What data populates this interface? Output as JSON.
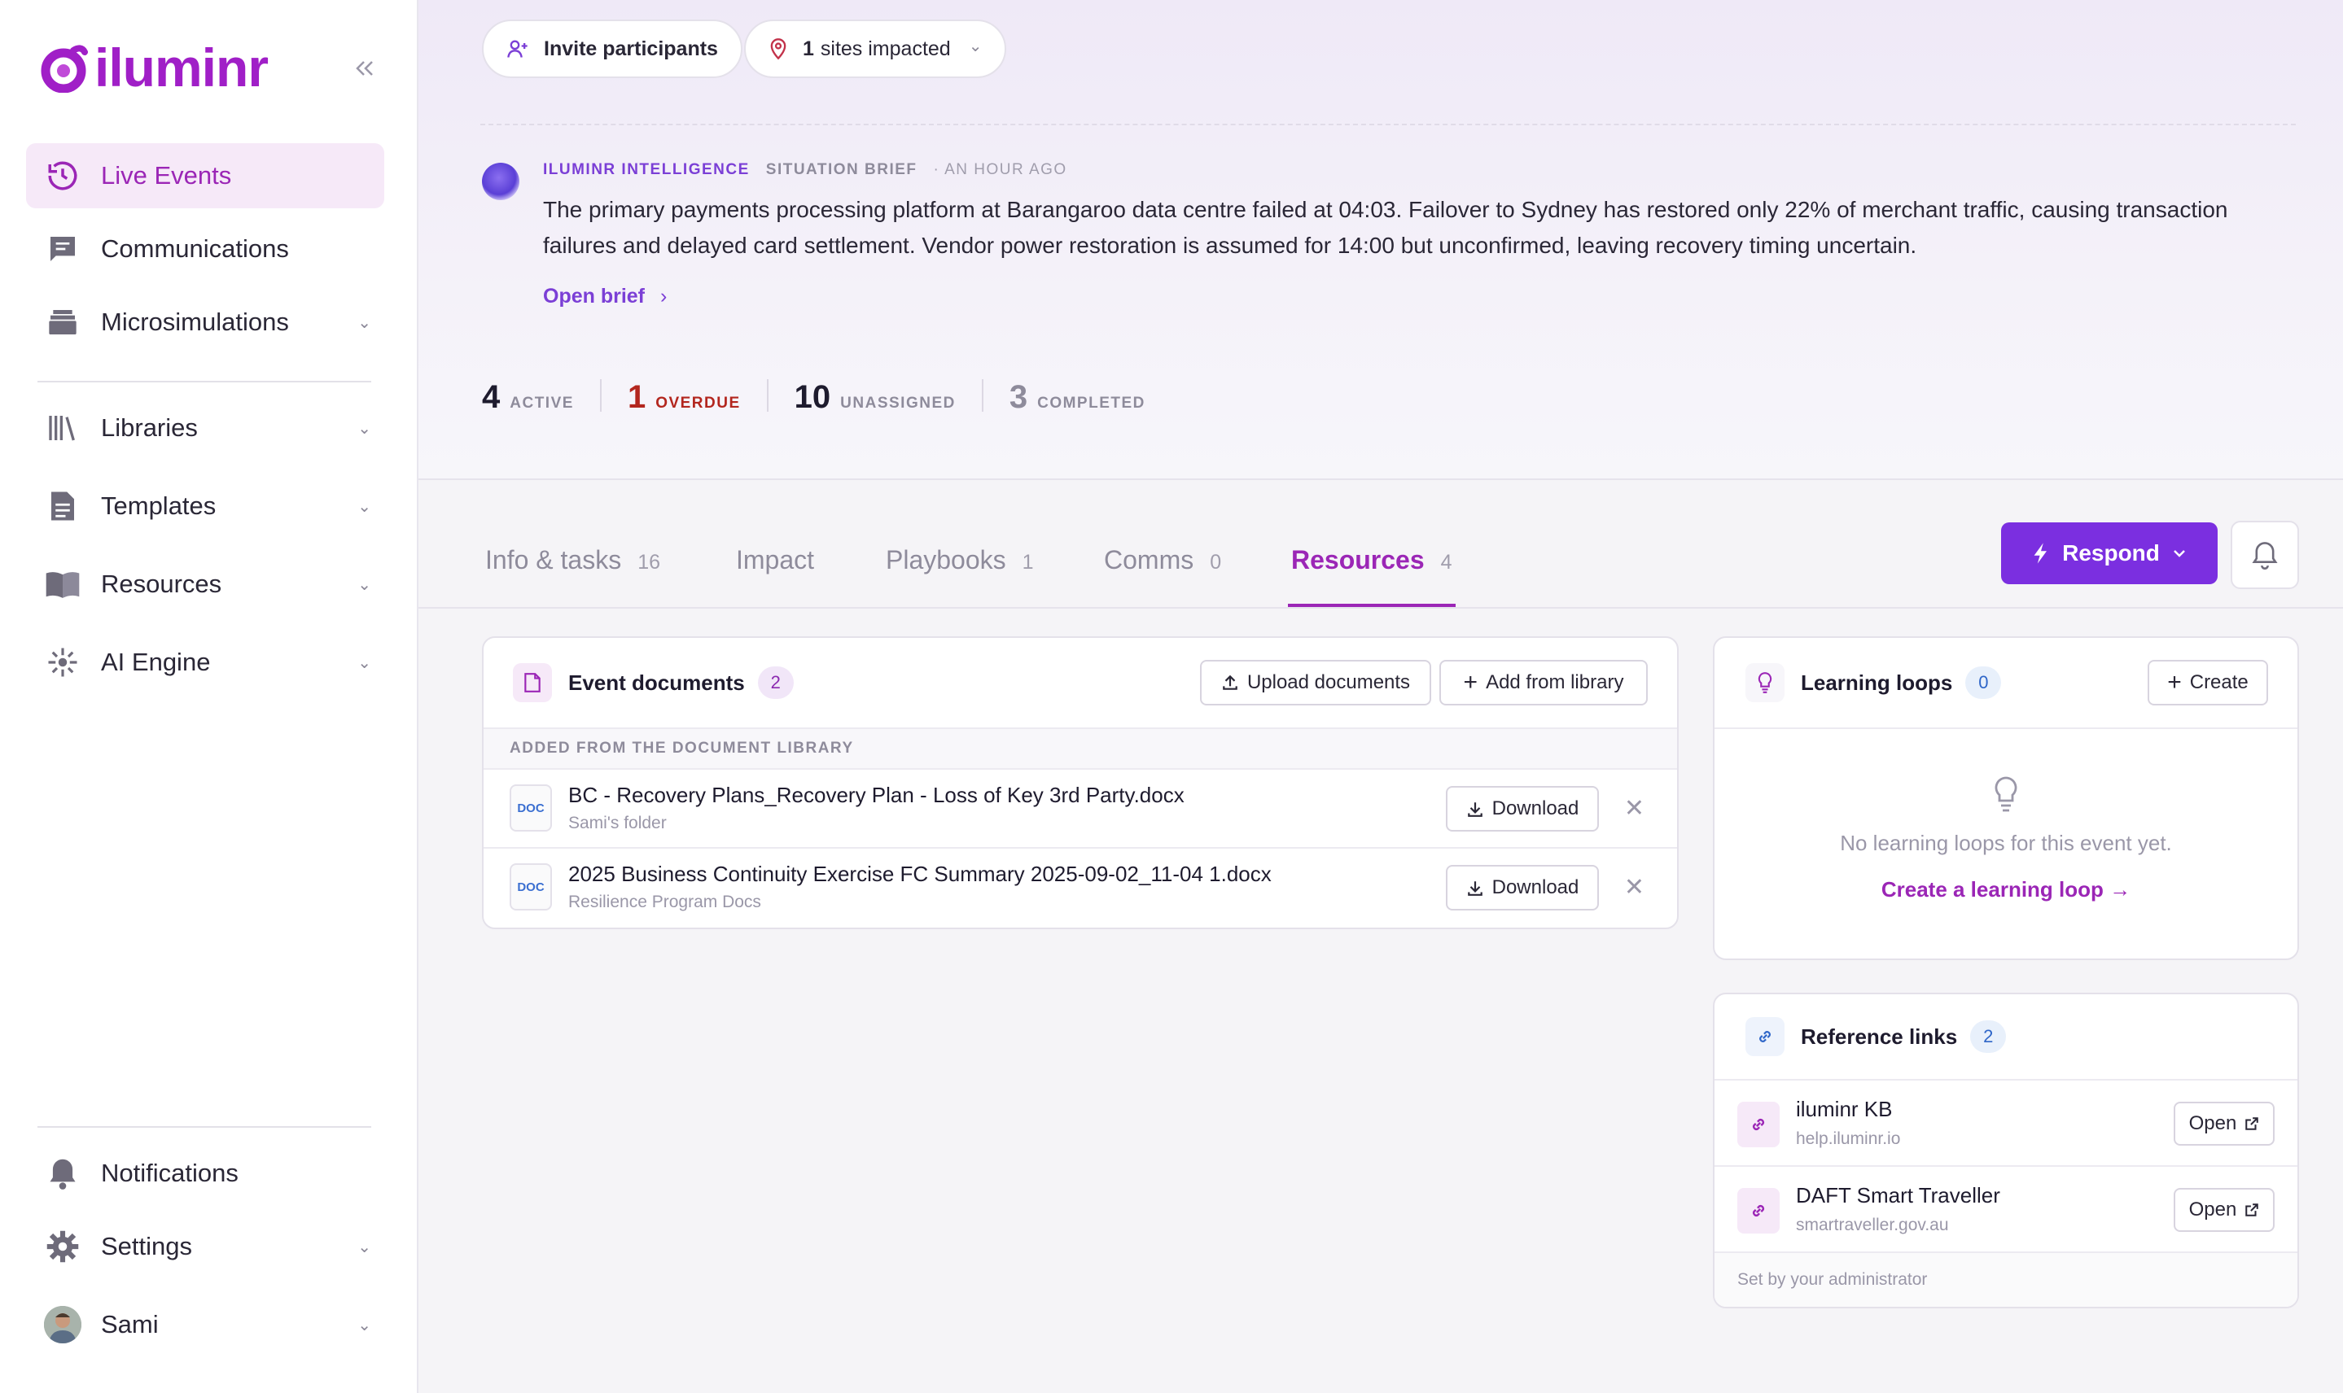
{
  "sidebar": {
    "logo_text": "iluminr",
    "collapse_icon": "chevrons-left-icon",
    "items": [
      {
        "label": "Live Events",
        "icon": "history-icon",
        "active": true
      },
      {
        "label": "Communications",
        "icon": "message-icon"
      },
      {
        "label": "Microsimulations",
        "icon": "layers-icon"
      },
      {
        "label": "Libraries",
        "icon": "library-icon"
      },
      {
        "label": "Templates",
        "icon": "file-text-icon"
      },
      {
        "label": "Resources",
        "icon": "book-open-icon"
      },
      {
        "label": "AI Engine",
        "icon": "sparkle-icon"
      }
    ],
    "bottom": [
      {
        "label": "Notifications",
        "icon": "bell-icon"
      },
      {
        "label": "Settings",
        "icon": "gear-icon"
      },
      {
        "label": "Sami",
        "icon": "avatar"
      }
    ]
  },
  "header": {
    "invite_label": "Invite participants",
    "sites_count": "1",
    "sites_label": "sites impacted"
  },
  "brief": {
    "source": "ILUMINR INTELLIGENCE",
    "kind": "SITUATION BRIEF",
    "time": "· AN HOUR AGO",
    "text": "The primary payments processing platform at Barangaroo data centre failed at 04:03. Failover to Sydney has restored only 22% of merchant traffic, causing transaction failures and delayed card settlement. Vendor power restoration is assumed for 14:00 but unconfirmed, leaving recovery timing uncertain.",
    "open_label": "Open brief"
  },
  "stats": [
    {
      "num": "4",
      "label": "ACTIVE",
      "color": "#1e1b2e"
    },
    {
      "num": "1",
      "label": "OVERDUE",
      "color": "#b3261e"
    },
    {
      "num": "10",
      "label": "UNASSIGNED",
      "color": "#1e1b2e"
    },
    {
      "num": "3",
      "label": "COMPLETED",
      "color": "#8e8b9b"
    }
  ],
  "tabs": [
    {
      "label": "Info & tasks",
      "count": "16"
    },
    {
      "label": "Impact",
      "count": ""
    },
    {
      "label": "Playbooks",
      "count": "1"
    },
    {
      "label": "Comms",
      "count": "0"
    },
    {
      "label": "Resources",
      "count": "4",
      "active": true
    }
  ],
  "respond_label": "Respond",
  "documents": {
    "title": "Event documents",
    "count": "2",
    "upload_label": "Upload documents",
    "add_label": "Add from library",
    "section_label": "ADDED FROM THE DOCUMENT LIBRARY",
    "file_badge": "DOC",
    "download_label": "Download",
    "items": [
      {
        "name": "BC - Recovery Plans_Recovery Plan - Loss of Key 3rd Party.docx",
        "folder": "Sami's folder"
      },
      {
        "name": "2025 Business Continuity Exercise FC Summary 2025-09-02_11-04 1.docx",
        "folder": "Resilience Program Docs"
      }
    ]
  },
  "learning": {
    "title": "Learning loops",
    "count": "0",
    "create_label": "Create",
    "empty_text": "No learning loops for this event yet.",
    "create_link": "Create a learning loop →"
  },
  "links": {
    "title": "Reference links",
    "count": "2",
    "open_label": "Open",
    "items": [
      {
        "name": "iluminr KB",
        "url": "help.iluminr.io"
      },
      {
        "name": "DAFT Smart Traveller",
        "url": "smartraveller.gov.au"
      }
    ],
    "footer": "Set by your administrator"
  },
  "colors": {
    "brand": "#a01fc7",
    "accent": "#7b2fe0",
    "overdue": "#b3261e"
  }
}
